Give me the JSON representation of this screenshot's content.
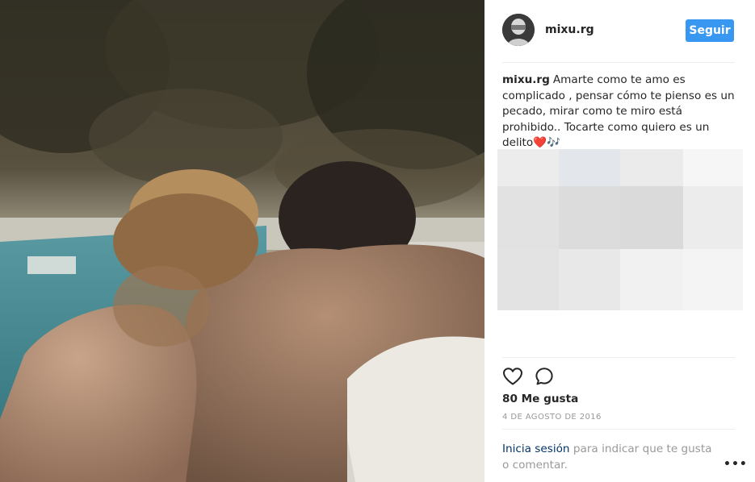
{
  "post": {
    "photo_alt": "",
    "author": {
      "username": "mixu.rg",
      "follow_label": "Seguir"
    },
    "caption": {
      "username": "mixu.rg",
      "text": "Amarte como te amo es complicado , pensar cómo te pienso es un pecado, mirar como te miro está prohibido.. Tocarte como quiero es un delito❤️🎶"
    },
    "actions": {
      "like_icon": "heart-icon",
      "comment_icon": "comment-icon"
    },
    "likes_text": "80 Me gusta",
    "date": "4 DE AGOSTO DE 2016",
    "login_prompt": {
      "link": "Inicia sesión",
      "rest": " para indicar que te gusta o comentar."
    },
    "more_label": "•••"
  },
  "colors": {
    "accent": "#3897f0",
    "text": "#262626",
    "muted": "#999999",
    "link": "#003569"
  }
}
